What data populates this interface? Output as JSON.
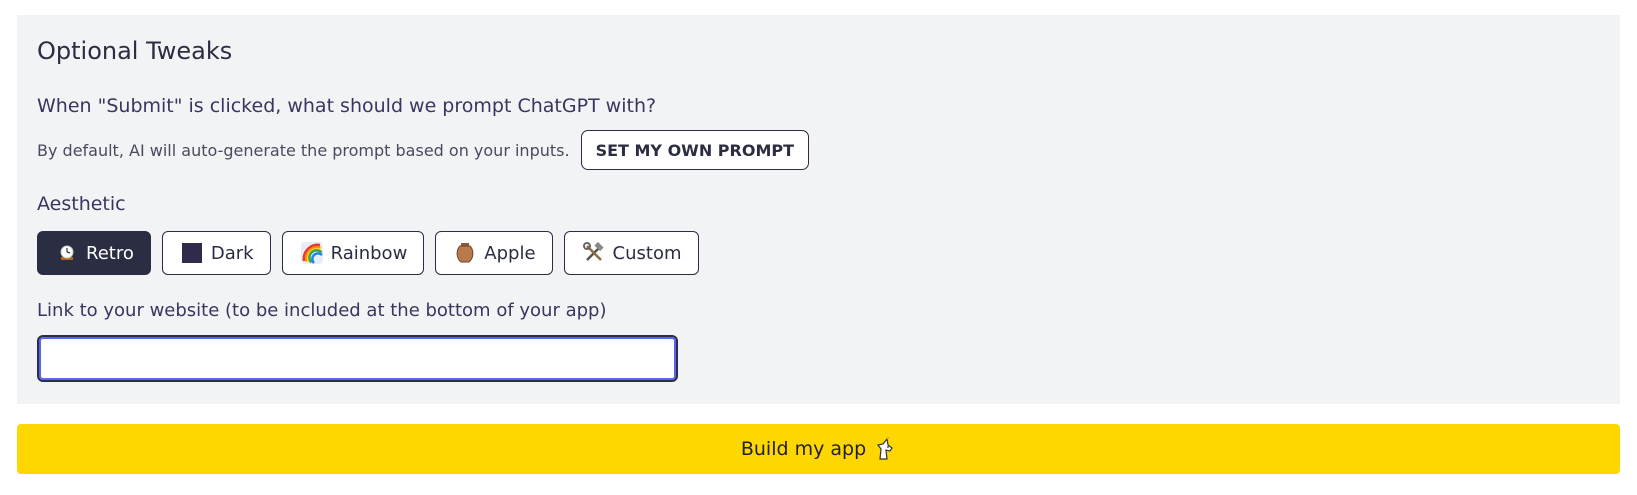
{
  "panel": {
    "title": "Optional Tweaks",
    "question": "When \"Submit\" is clicked, what should we prompt ChatGPT with?",
    "default_text": "By default, AI will auto-generate the prompt based on your inputs.",
    "own_prompt_label": "SET MY OWN PROMPT"
  },
  "aesthetic": {
    "label": "Aesthetic",
    "selected": "Retro",
    "options": [
      {
        "label": "Retro",
        "icon": "clock-icon"
      },
      {
        "label": "Dark",
        "icon": "dark-square-icon"
      },
      {
        "label": "Rainbow",
        "icon": "rainbow-icon"
      },
      {
        "label": "Apple",
        "icon": "amphora-icon"
      },
      {
        "label": "Custom",
        "icon": "hammer-wrench-icon"
      }
    ]
  },
  "link": {
    "label": "Link to your website (to be included at the bottom of your app)",
    "value": "",
    "placeholder": ""
  },
  "build": {
    "label": "Build my app",
    "icon": "unicorn-icon"
  },
  "colors": {
    "panel_bg": "#f2f3f5",
    "dark": "#2b2d42",
    "accent_yellow": "#ffd700",
    "focus_ring": "#5865f2"
  }
}
